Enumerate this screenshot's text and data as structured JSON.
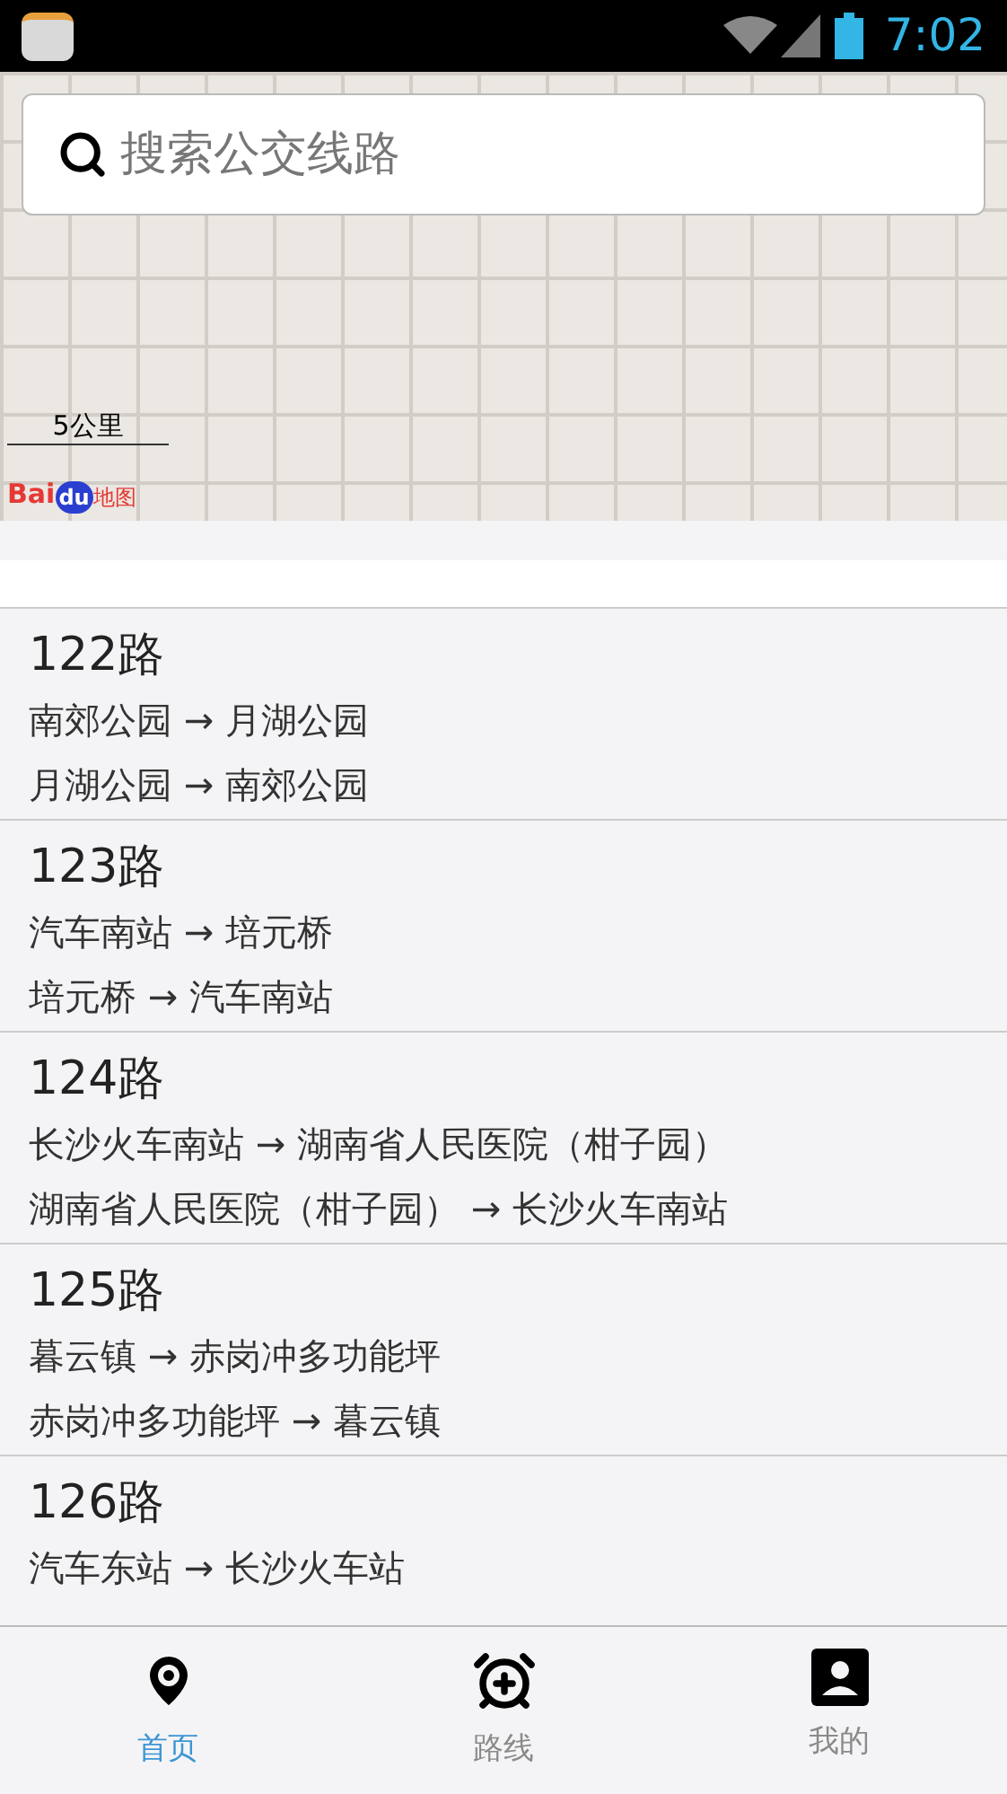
{
  "status_bar": {
    "time": "7:02"
  },
  "search": {
    "placeholder": "搜索公交线路"
  },
  "map": {
    "scale": "5公里",
    "logo": {
      "part_1": "Bai",
      "part_2": "du",
      "part_3": "地图"
    }
  },
  "routes": [
    {
      "name": "122路",
      "directions": [
        "南郊公园 → 月湖公园",
        "月湖公园 → 南郊公园"
      ]
    },
    {
      "name": "123路",
      "directions": [
        "汽车南站 → 培元桥",
        "培元桥 → 汽车南站"
      ]
    },
    {
      "name": "124路",
      "directions": [
        "长沙火车南站 → 湖南省人民医院（柑子园）",
        "湖南省人民医院（柑子园） → 长沙火车南站"
      ]
    },
    {
      "name": "125路",
      "directions": [
        "暮云镇 → 赤岗冲多功能坪",
        "赤岗冲多功能坪 → 暮云镇"
      ]
    },
    {
      "name": "126路",
      "directions": [
        "汽车东站 → 长沙火车站"
      ]
    }
  ],
  "tabs": [
    {
      "kind": "home",
      "label": "首页",
      "selected": true
    },
    {
      "kind": "routes",
      "label": "路线",
      "selected": false
    },
    {
      "kind": "mine",
      "label": "我的",
      "selected": false
    }
  ]
}
